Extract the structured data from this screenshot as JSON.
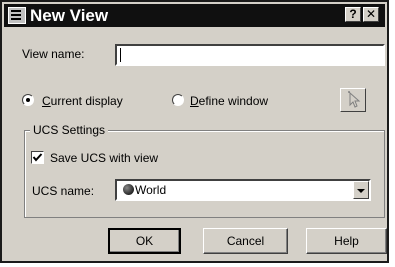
{
  "window": {
    "title": "New View",
    "help_glyph": "?",
    "close_glyph": "✕"
  },
  "view_name": {
    "label": "View name:",
    "value": ""
  },
  "radios": {
    "current_display": {
      "label": "Current display",
      "mnemonic": "C",
      "rest": "urrent display",
      "selected": true
    },
    "define_window": {
      "label": "Define window",
      "mnemonic": "D",
      "rest": "efine window",
      "selected": false
    }
  },
  "pick_button": {
    "icon": "cursor-arrow-icon"
  },
  "ucs": {
    "group_title": "UCS Settings",
    "save_label": "Save UCS with view",
    "save_checked": true,
    "name_label": "UCS name:",
    "selected": "World"
  },
  "buttons": {
    "ok": "OK",
    "cancel": "Cancel",
    "help": "Help"
  }
}
